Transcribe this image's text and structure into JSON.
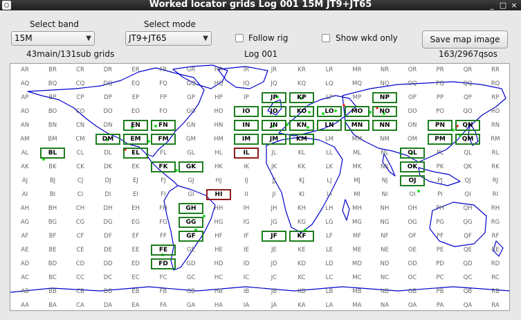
{
  "window": {
    "title": "Worked locator grids Log 001 15M JT9+JT65",
    "controls": [
      "_",
      "□",
      "×"
    ]
  },
  "controls": {
    "band_label": "Select band",
    "band_value": "15M",
    "mode_label": "Select mode",
    "mode_value": "JT9+JT65",
    "follow_rig_label": "Follow rig",
    "follow_rig_checked": false,
    "wkd_only_label": "Show wkd only",
    "wkd_only_checked": false,
    "save_button": "Save map image"
  },
  "stats": {
    "grids": "43main/131sub grids",
    "log": "Log 001",
    "qsos": "163/2967qsos"
  },
  "map": {
    "columns": [
      "A",
      "B",
      "C",
      "D",
      "E",
      "F",
      "G",
      "H",
      "I",
      "J",
      "K",
      "L",
      "M",
      "N",
      "O",
      "P",
      "Q",
      "R"
    ],
    "rows": [
      "R",
      "Q",
      "P",
      "O",
      "N",
      "M",
      "L",
      "K",
      "J",
      "I",
      "H",
      "G",
      "F",
      "E",
      "D",
      "C",
      "B",
      "A"
    ],
    "worked_grids": [
      "JP",
      "KP",
      "NP",
      "IO",
      "JO",
      "KO",
      "LO",
      "MO",
      "NO",
      "EN",
      "FN",
      "IN",
      "JN",
      "KN",
      "LN",
      "MN",
      "NN",
      "PN",
      "QN",
      "DM",
      "EM",
      "FM",
      "IM",
      "JM",
      "KM",
      "PM",
      "QM",
      "BL",
      "EL",
      "OL",
      "FK",
      "GK",
      "OK",
      "OJ",
      "GH",
      "GG",
      "GF",
      "JF",
      "KF",
      "FE",
      "FD"
    ],
    "main_grids": [
      "IL",
      "HI"
    ],
    "colors": {
      "worked": "#1c7d1c",
      "main": "#8b1a1a",
      "coast": "#0000cc",
      "spot": "#22dd22",
      "dot": "#ff2222"
    }
  }
}
